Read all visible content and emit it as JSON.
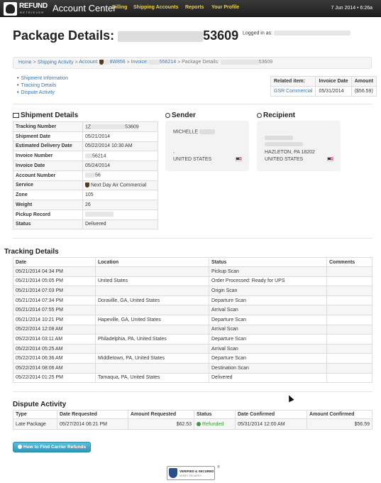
{
  "topbar": {
    "logo_text": "REFUND",
    "logo_sub": "RETRIEVER",
    "brand": "Account Center",
    "nav": [
      "Billing",
      "Shipping Accounts",
      "Reports",
      "Your Profile"
    ],
    "date": "7 Jun 2014 • 6:26a"
  },
  "header": {
    "title_prefix": "Package Details:",
    "title_suffix": "53609",
    "logged_in_label": "Logged in as:"
  },
  "breadcrumb": {
    "home": "Home",
    "activity": "Shipping Activity",
    "account_prefix": "Account:",
    "account": "8W856",
    "invoice_prefix": "Invoice:",
    "invoice": "556214",
    "current_prefix": "Package Details:",
    "current_suffix": "53609",
    "sep": ">"
  },
  "sublinks": [
    "Shipment Information",
    "Tracking Details",
    "Dispute Activity"
  ],
  "related": {
    "headers": [
      "Related item:",
      "Invoice Date",
      "Amount"
    ],
    "row": {
      "item": "GSR Commercial",
      "date": "05/31/2014",
      "amount": "($56.59)"
    }
  },
  "shipment": {
    "title": "Shipment Details",
    "rows": [
      {
        "k": "Tracking Number",
        "v": "1Z",
        "v2": "53609"
      },
      {
        "k": "Shipment Date",
        "v": "05/21/2014"
      },
      {
        "k": "Estimated Delivery Date",
        "v": "05/22/2014 10:30 AM"
      },
      {
        "k": "Invoice Number",
        "v": "",
        "v2": "56214"
      },
      {
        "k": "Invoice Date",
        "v": "05/24/2014"
      },
      {
        "k": "Account Number",
        "v": "",
        "v2": "56"
      },
      {
        "k": "Service",
        "v": "Next Day Air Commercial"
      },
      {
        "k": "Zone",
        "v": "105"
      },
      {
        "k": "Weight",
        "v": "26"
      },
      {
        "k": "Pickup Record",
        "v": ""
      },
      {
        "k": "Status",
        "v": "Delivered"
      }
    ]
  },
  "sender": {
    "title": "Sender",
    "name": "MICHELLE",
    "comma": ",",
    "country": "UNITED STATES"
  },
  "recipient": {
    "title": "Recipient",
    "city": "HAZLETON, PA 18202",
    "country": "UNITED STATES"
  },
  "tracking": {
    "title": "Tracking Details",
    "headers": [
      "Date",
      "Location",
      "Status",
      "Comments"
    ],
    "rows": [
      [
        "05/21/2014 04:34 PM",
        "",
        "Pickup Scan",
        ""
      ],
      [
        "05/21/2014 05:05 PM",
        "United States",
        "Order Processed: Ready for UPS",
        ""
      ],
      [
        "05/21/2014 07:03 PM",
        "",
        "Origin Scan",
        ""
      ],
      [
        "05/21/2014 07:34 PM",
        "Doraville, GA, United States",
        "Departure Scan",
        ""
      ],
      [
        "05/21/2014 07:55 PM",
        "",
        "Arrival Scan",
        ""
      ],
      [
        "05/21/2014 10:21 PM",
        "Hapeville, GA, United States",
        "Departure Scan",
        ""
      ],
      [
        "05/22/2014 12:08 AM",
        "",
        "Arrival Scan",
        ""
      ],
      [
        "05/22/2014 03:11 AM",
        "Philadelphia, PA, United States",
        "Departure Scan",
        ""
      ],
      [
        "05/22/2014 05:25 AM",
        "",
        "Arrival Scan",
        ""
      ],
      [
        "05/22/2014 06:36 AM",
        "Middletown, PA, United States",
        "Departure Scan",
        ""
      ],
      [
        "05/22/2014 08:06 AM",
        "",
        "Destination Scan",
        ""
      ],
      [
        "05/22/2014 01:25 PM",
        "Tamaqua, PA, United States",
        "Delivered",
        ""
      ]
    ]
  },
  "dispute": {
    "title": "Dispute Activity",
    "headers": [
      "Type",
      "Date Requested",
      "Amount Requested",
      "Status",
      "Date Confirmed",
      "Amount Confirmed"
    ],
    "row": [
      "Late Package",
      "05/27/2014 06:21 PM",
      "$62.53",
      "Refunded",
      "05/31/2014 12:00 AM",
      "$56.59"
    ]
  },
  "button": "How to Find Carrier Refunds",
  "badge": {
    "line1": "VERIFIED & SECURED",
    "line2": "VERIFY SECURITY",
    "mark": "®"
  }
}
